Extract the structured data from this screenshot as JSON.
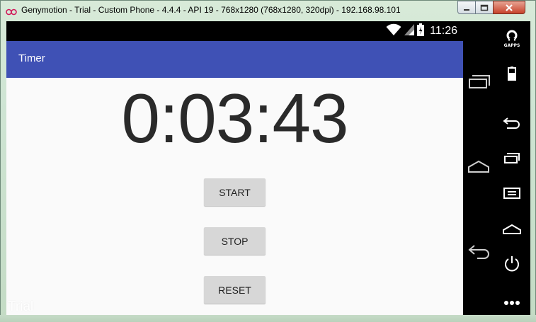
{
  "window": {
    "title": "Genymotion - Trial - Custom Phone - 4.4.4 - API 19 - 768x1280 (768x1280, 320dpi) - 192.168.98.101",
    "icons": [
      "genymotion-logo-icon",
      "minimize-icon",
      "maximize-icon",
      "close-icon"
    ]
  },
  "statusbar": {
    "time": "11:26",
    "icons": [
      "wifi-icon",
      "signal-icon",
      "battery-icon"
    ]
  },
  "app": {
    "title": "Timer",
    "timer_value": "0:03:43",
    "buttons": {
      "start": "START",
      "stop": "STOP",
      "reset": "RESET"
    }
  },
  "watermark": "Trial",
  "phone_nav": {
    "icons": [
      "recent-apps-icon",
      "home-icon",
      "back-icon"
    ]
  },
  "genymotion_toolbar": {
    "gapps_label": "GAPPS",
    "icons": [
      "gapps-icon",
      "battery-icon",
      "back-icon",
      "recent-apps-icon",
      "menu-icon",
      "home-icon",
      "power-icon",
      "more-icon"
    ]
  },
  "colors": {
    "appbar": "#3f51b5",
    "screen_bg": "#fafafa",
    "button_bg": "#d7d7d7",
    "timer_text": "#2a2a2a"
  }
}
